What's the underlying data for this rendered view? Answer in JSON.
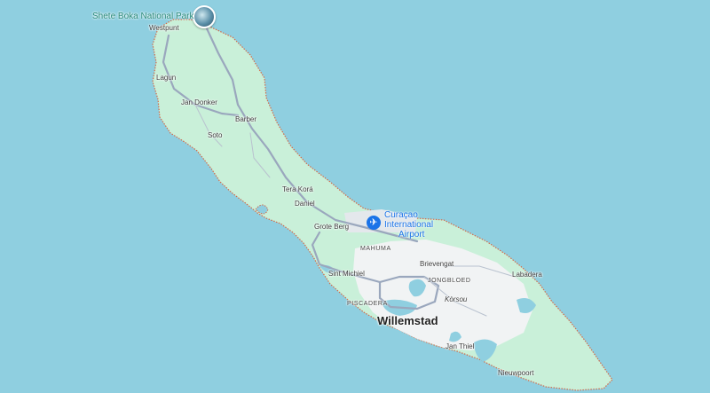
{
  "map": {
    "colors": {
      "water": "#8fcfe0",
      "land": "#c9f0d9",
      "urban": "#f1f3f4",
      "road": "#9aa7bd",
      "coast": "#d46a4a",
      "airport": "#1a73e8",
      "park_label": "#2a8a7a"
    },
    "poi": {
      "name": "Shete Boka National Park",
      "icon": "park-photo-icon"
    },
    "airport": {
      "line1": "Curaçao",
      "line2": "International",
      "line3": "Airport",
      "icon": "airplane-icon"
    },
    "places": {
      "westpunt": "Westpunt",
      "lagun": "Lagun",
      "jan_donker": "Jan Donker",
      "barber": "Barber",
      "soto": "Soto",
      "tera_kora": "Tera Korá",
      "daniel": "Daniel",
      "grote_berg": "Grote Berg",
      "mahuma": "MAHUMA",
      "brievengat": "Brievengat",
      "jongbloed": "JONGBLOED",
      "korsou": "Kòrsou",
      "sint_michiel": "Sint Michiel",
      "piscadera": "PISCADERA",
      "willemstad": "Willemstad",
      "jan_thiel": "Jan Thiel",
      "labadera": "Labadera",
      "nieuwpoort": "Nieuwpoort"
    }
  }
}
